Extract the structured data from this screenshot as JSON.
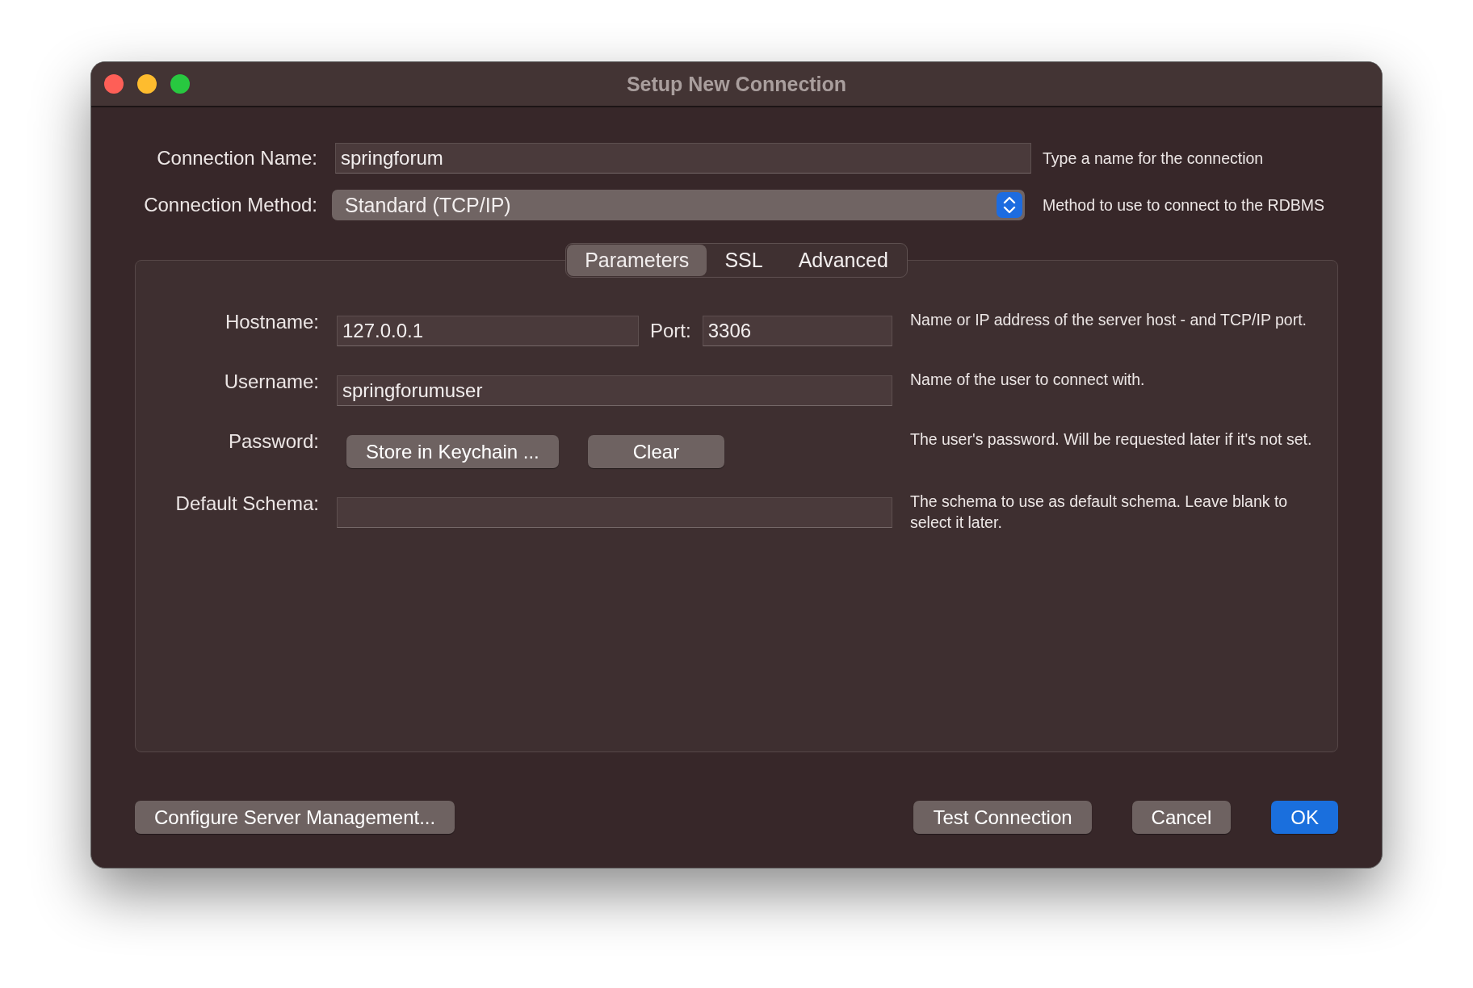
{
  "window": {
    "title": "Setup New Connection"
  },
  "connection_name": {
    "label": "Connection Name:",
    "value": "springforum",
    "hint": "Type a name for the connection"
  },
  "connection_method": {
    "label": "Connection Method:",
    "value": "Standard (TCP/IP)",
    "hint": "Method to use to connect to the RDBMS"
  },
  "tabs": [
    {
      "label": "Parameters",
      "selected": true
    },
    {
      "label": "SSL",
      "selected": false
    },
    {
      "label": "Advanced",
      "selected": false
    }
  ],
  "parameters": [
    {
      "kind": "host",
      "label": "Hostname:",
      "value": "127.0.0.1",
      "port_label": "Port:",
      "port_value": "3306",
      "hint": "Name or IP address of the server host - and TCP/IP port."
    },
    {
      "kind": "text",
      "label": "Username:",
      "value": "springforumuser",
      "hint": "Name of the user to connect with."
    },
    {
      "kind": "buttons",
      "label": "Password:",
      "buttons": [
        "Store in Keychain ...",
        "Clear"
      ],
      "hint": "The user's password. Will be requested later if it's not set."
    },
    {
      "kind": "text",
      "label": "Default Schema:",
      "hint": "The schema to use as default schema. Leave blank to select it later."
    }
  ],
  "footer": {
    "left_button": "Configure Server Management...",
    "buttons": [
      {
        "label": "Test Connection",
        "primary": false
      },
      {
        "label": "Cancel",
        "primary": false
      },
      {
        "label": "OK",
        "primary": true
      }
    ]
  }
}
